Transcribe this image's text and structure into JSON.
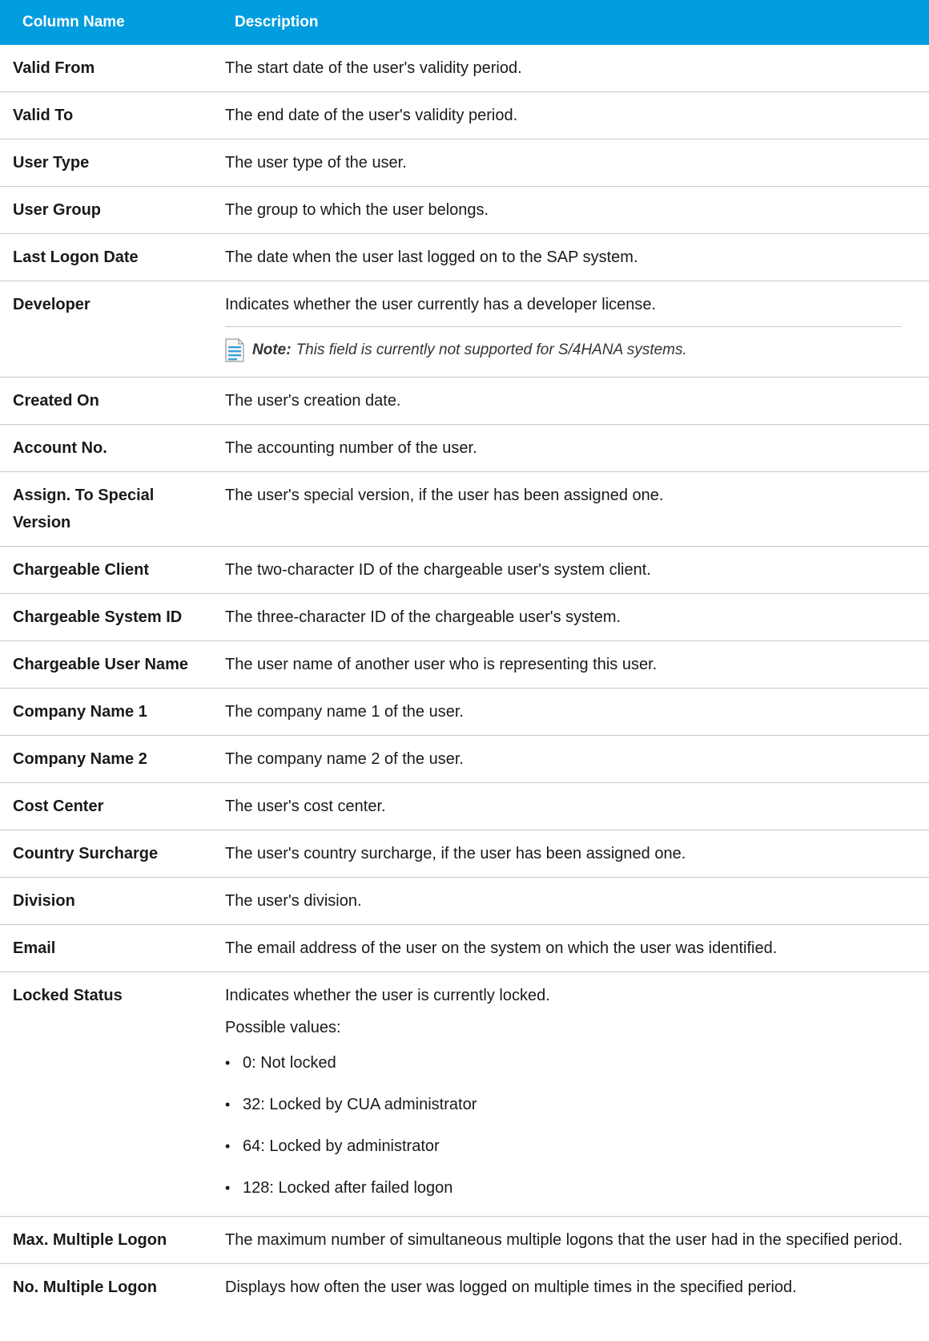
{
  "header": {
    "col_name": "Column Name",
    "col_desc": "Description"
  },
  "rows": [
    {
      "name": "Valid From",
      "desc": "The start date of the user's validity period."
    },
    {
      "name": "Valid To",
      "desc": "The end date of the user's validity period."
    },
    {
      "name": "User Type",
      "desc": "The user type of the user."
    },
    {
      "name": "User Group",
      "desc": "The group to which the user belongs."
    },
    {
      "name": "Last Logon Date",
      "desc": "The date when the user last logged on to the SAP system."
    },
    {
      "name": "Developer",
      "desc": "Indicates whether the user currently has a developer license."
    },
    {
      "name": "Created On",
      "desc": "The user's creation date."
    },
    {
      "name": "Account No.",
      "desc": "The accounting number of the user."
    },
    {
      "name": "Assign. To Special Version",
      "desc": "The user's special version, if the user has been assigned one."
    },
    {
      "name": "Chargeable Client",
      "desc": "The two-character ID of the chargeable user's system client."
    },
    {
      "name": "Chargeable System ID",
      "desc": "The three-character ID of the chargeable user's system."
    },
    {
      "name": "Chargeable User Name",
      "desc": "The user name of another user who is representing this user."
    },
    {
      "name": "Company Name 1",
      "desc": "The company name 1 of the user."
    },
    {
      "name": "Company Name 2",
      "desc": "The company name 2 of the user."
    },
    {
      "name": "Cost Center",
      "desc": "The user's cost center."
    },
    {
      "name": "Country Surcharge",
      "desc": "The user's country surcharge, if the user has been assigned one."
    },
    {
      "name": "Division",
      "desc": "The user's division."
    },
    {
      "name": "Email",
      "desc": "The email address of the user on the system on which the user was identified."
    },
    {
      "name": "Locked Status",
      "desc": "Indicates whether the user is currently locked."
    },
    {
      "name": "Max. Multiple Logon",
      "desc": "The maximum number of simultaneous multiple logons that the user had in the specified period."
    },
    {
      "name": "No. Multiple Logon",
      "desc": "Displays how often the user was logged on multiple times in the specified period."
    }
  ],
  "developer_note": {
    "label": "Note:",
    "text": "This field is currently not supported for S/4HANA systems.",
    "icon": "note-document-icon"
  },
  "locked_status": {
    "possible_values_label": "Possible values:",
    "values": [
      "0: Not locked",
      "32: Locked by CUA administrator",
      "64: Locked by administrator",
      "128: Locked after failed logon"
    ]
  },
  "colors": {
    "header_bg": "#009ddf",
    "header_text": "#ffffff",
    "row_border": "#c8c8c8"
  }
}
